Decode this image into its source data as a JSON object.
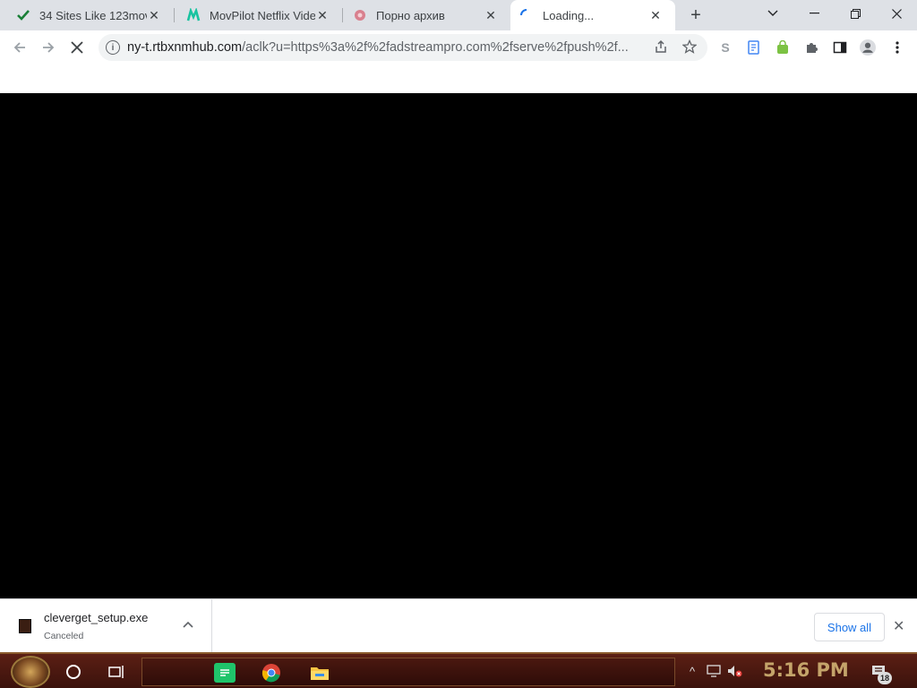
{
  "tabs": [
    {
      "title": "34 Sites Like 123movies",
      "favicon": "checkmark-icon",
      "color": "#1a7f37"
    },
    {
      "title": "MovPilot Netflix Video",
      "favicon": "movpilot-m-icon",
      "color": "#19c3a0"
    },
    {
      "title": "Порно архив",
      "favicon": "pink-flower-icon",
      "color": "#d9808e"
    },
    {
      "title": "Loading...",
      "favicon": "loading-spinner-icon",
      "active": true
    }
  ],
  "url": {
    "host": "ny-t.rtbxnmhub.com",
    "path": "/aclk?u=https%3a%2f%2fadstreampro.com%2fserve%2fpush%2f..."
  },
  "downloads": {
    "filename": "cleverget_setup.exe",
    "status": "Canceled",
    "show_all": "Show all"
  },
  "taskbar": {
    "clock": "5:16 PM",
    "notification_count": "18"
  },
  "colors": {
    "accent": "#1a73e8",
    "taskbar": "#4a1810"
  }
}
